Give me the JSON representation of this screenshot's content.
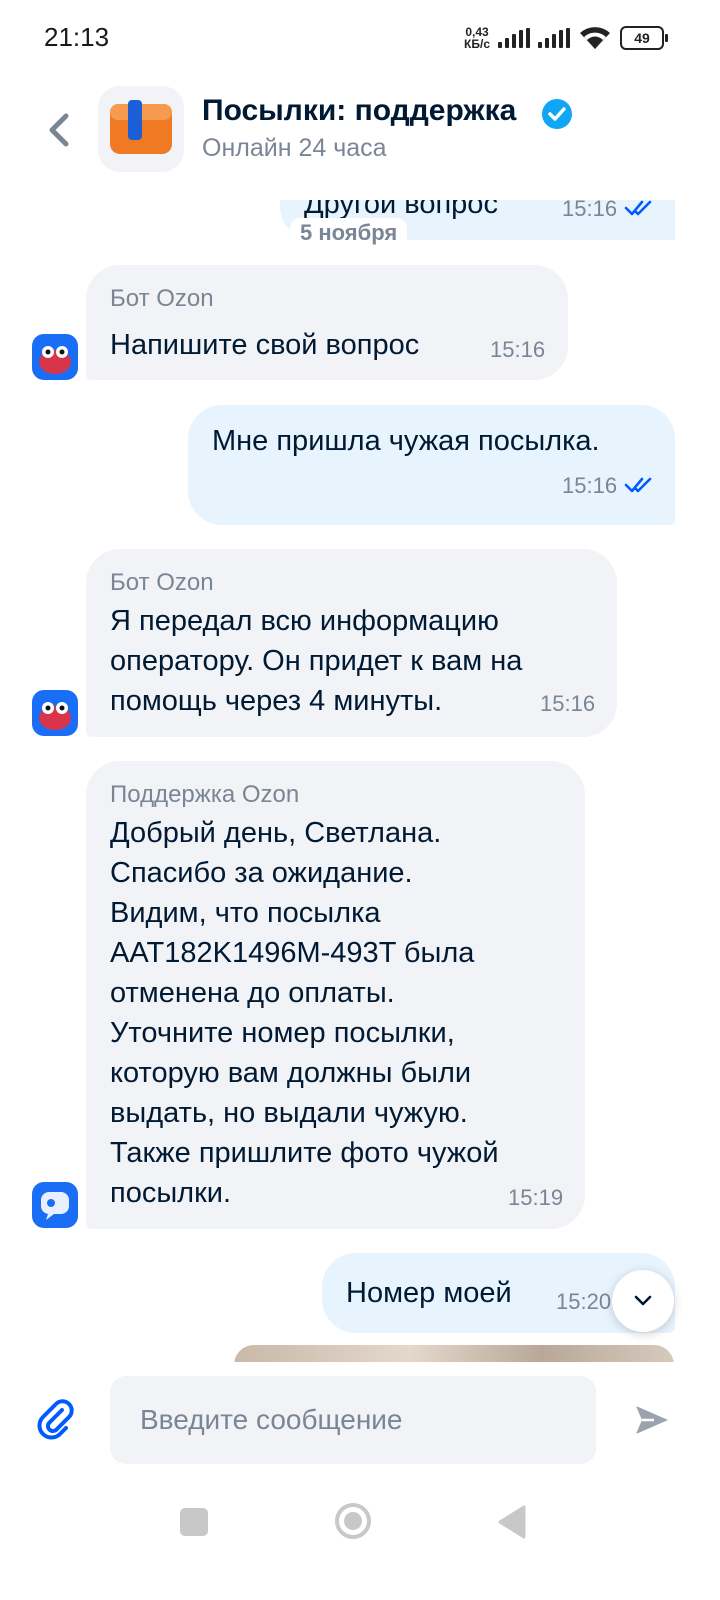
{
  "status_bar": {
    "time": "21:13",
    "net_speed_value": "0,43",
    "net_speed_unit": "КБ/с",
    "battery": "49"
  },
  "header": {
    "title": "Посылки: поддержка",
    "subtitle": "Онлайн 24 часа",
    "verified_icon": "verified-check-icon"
  },
  "messages": {
    "partial_top": {
      "text": "Другой вопрос",
      "time": "15:16"
    },
    "date_separator": "5 ноября",
    "m1": {
      "sender": "Бот Ozon",
      "text": "Напишите свой вопрос",
      "time": "15:16"
    },
    "m2": {
      "text": "Мне пришла чужая посылка.",
      "time": "15:16"
    },
    "m3": {
      "sender": "Бот Ozon",
      "lines": [
        "Я передал всю информацию",
        "оператору. Он придет к вам на",
        "помощь через 4 минуты."
      ],
      "time": "15:16"
    },
    "m4": {
      "sender": "Поддержка Ozon",
      "lines": [
        "Добрый день, Светлана.",
        "Спасибо за ожидание.",
        "Видим, что посылка",
        "AAT182K1496M-493T была",
        "отменена до оплаты.",
        "Уточните номер посылки,",
        "которую вам должны были",
        "выдать, но выдали чужую.",
        "Также пришлите фото чужой",
        "посылки."
      ],
      "time": "15:19"
    },
    "m5": {
      "text": "Номер моей",
      "time": "15:20"
    }
  },
  "composer": {
    "placeholder": "Введите сообщение"
  },
  "colors": {
    "accent": "#005bff",
    "incoming_bubble": "#f2f3f7",
    "outgoing_bubble": "#e7f3fd",
    "secondary_text": "#7a8595"
  }
}
